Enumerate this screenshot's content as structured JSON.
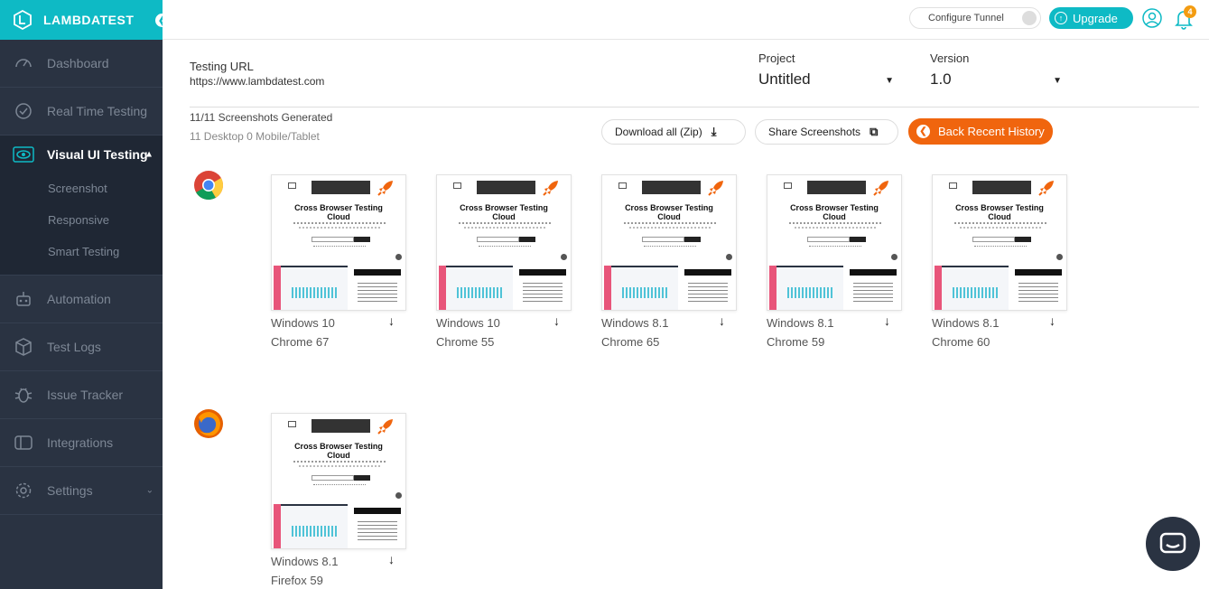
{
  "brand": {
    "name": "LAMBDATEST"
  },
  "sidebar": {
    "items": [
      {
        "label": "Dashboard",
        "icon": "speedometer-icon"
      },
      {
        "label": "Real Time Testing",
        "icon": "clock-icon"
      },
      {
        "label": "Visual UI Testing",
        "icon": "eye-icon",
        "active": true
      },
      {
        "label": "Automation",
        "icon": "robot-icon"
      },
      {
        "label": "Test Logs",
        "icon": "box-icon"
      },
      {
        "label": "Issue Tracker",
        "icon": "bug-icon"
      },
      {
        "label": "Integrations",
        "icon": "integration-icon"
      },
      {
        "label": "Settings",
        "icon": "gear-icon"
      }
    ],
    "subitems": [
      "Screenshot",
      "Responsive",
      "Smart Testing"
    ]
  },
  "header": {
    "tunnel_label": "Configure Tunnel",
    "upgrade_label": "Upgrade",
    "notification_count": "4"
  },
  "main": {
    "testing_url_label": "Testing URL",
    "testing_url": "https://www.lambdatest.com",
    "project_label": "Project",
    "project_value": "Untitled",
    "version_label": "Version",
    "version_value": "1.0",
    "generated": "11/11 Screenshots Generated",
    "generated_sub": "11 Desktop 0 Mobile/Tablet",
    "download_all": "Download all (Zip)",
    "share": "Share Screenshots",
    "back": "Back Recent History"
  },
  "thumbnail_title_line1": "Cross Browser Testing",
  "thumbnail_title_line2": "Cloud",
  "chrome_shots": [
    {
      "os": "Windows 10",
      "browser": "Chrome 67"
    },
    {
      "os": "Windows 10",
      "browser": "Chrome 55"
    },
    {
      "os": "Windows 8.1",
      "browser": "Chrome 65"
    },
    {
      "os": "Windows 8.1",
      "browser": "Chrome 59"
    },
    {
      "os": "Windows 8.1",
      "browser": "Chrome 60"
    }
  ],
  "firefox_shots": [
    {
      "os": "Windows 8.1",
      "browser": "Firefox 59"
    }
  ],
  "colors": {
    "accent": "#0ebac5",
    "sidebar": "#2a3342",
    "orange": "#f0650e"
  }
}
